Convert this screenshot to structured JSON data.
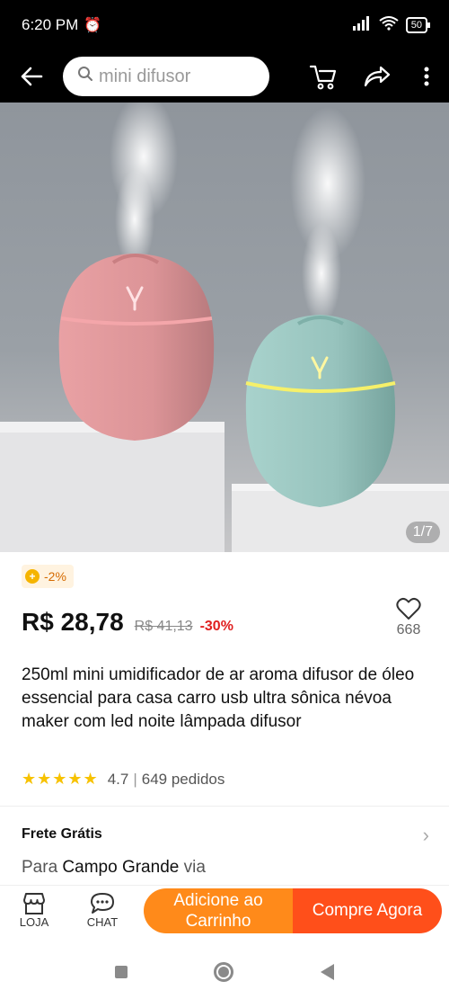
{
  "status_bar": {
    "time": "6:20 PM",
    "battery": "50"
  },
  "header": {
    "search_placeholder": "mini difusor"
  },
  "gallery": {
    "counter": "1/7"
  },
  "promo": {
    "label": "-2%"
  },
  "product": {
    "price": "R$ 28,78",
    "old_price": "R$ 41,13",
    "discount": "-30%",
    "favorites_count": "668",
    "title": "250ml mini umidificador de ar aroma difusor de óleo essencial para casa carro usb ultra sônica névoa maker com led noite lâmpada difusor",
    "rating": "4.7",
    "orders": "649 pedidos"
  },
  "shipping": {
    "title": "Frete Grátis",
    "destination_prefix": "Para",
    "destination": "Campo Grande",
    "destination_suffix": "via"
  },
  "bottom_bar": {
    "store_label": "LOJA",
    "chat_label": "CHAT",
    "add_to_cart_label": "Adicione ao Carrinho",
    "buy_now_label": "Compre Agora"
  },
  "colors": {
    "accent_orange": "#ff8a1a",
    "accent_red": "#ff4f1a",
    "discount_red": "#e02020",
    "star_yellow": "#f7c200"
  }
}
